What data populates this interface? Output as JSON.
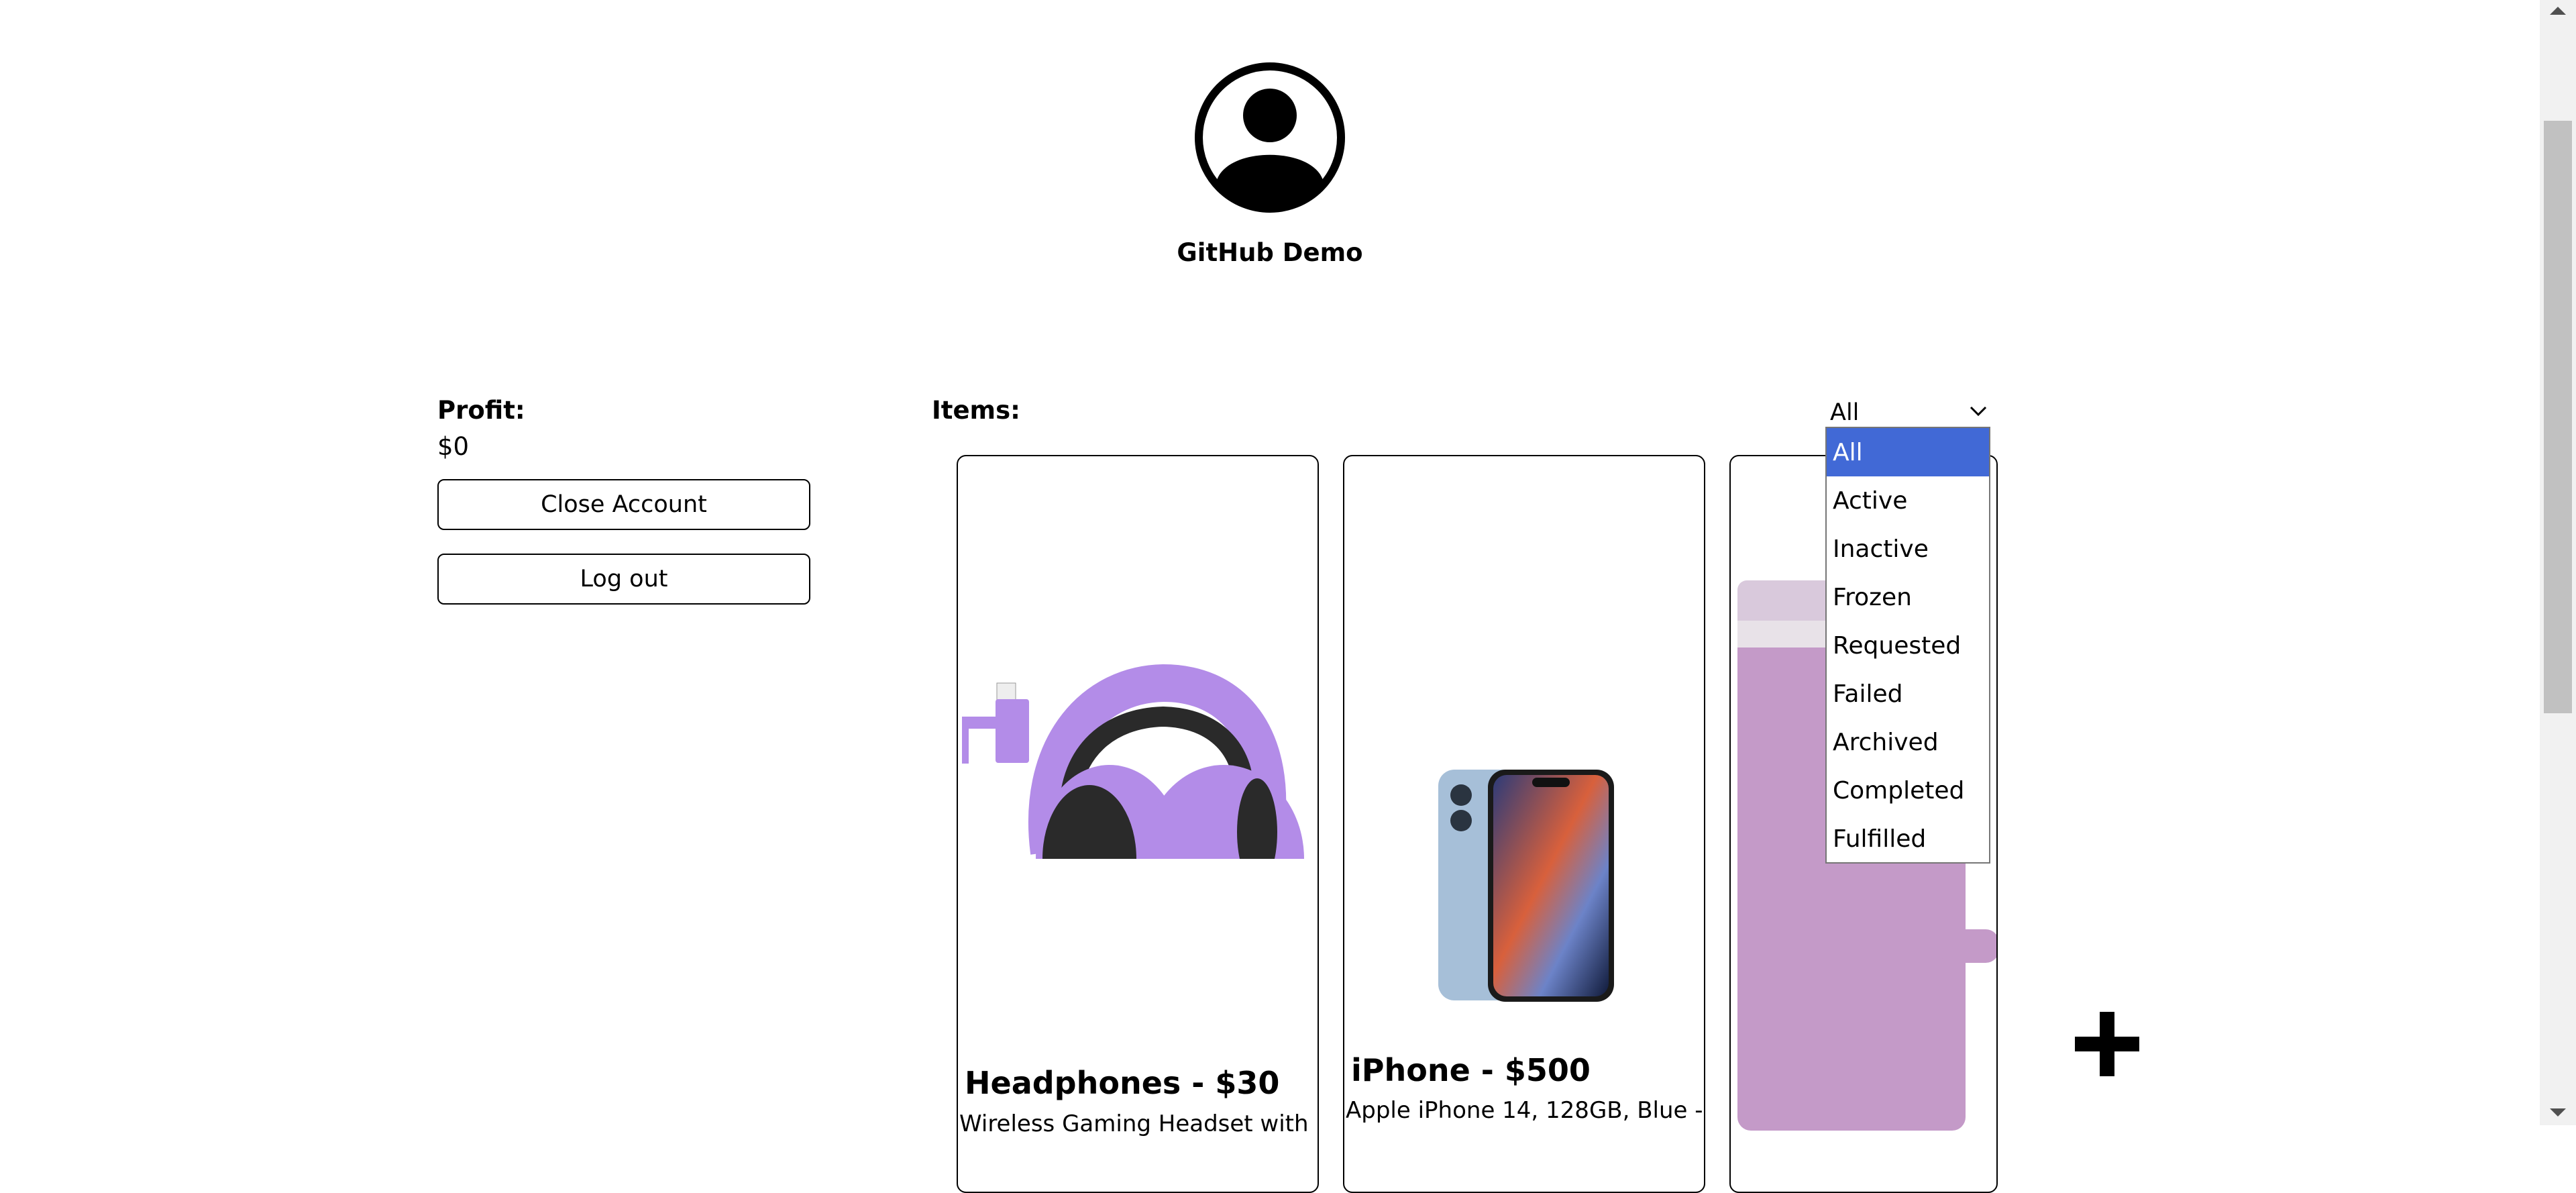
{
  "profile": {
    "username": "GitHub Demo"
  },
  "profit": {
    "label": "Profit:",
    "value": "$0"
  },
  "account": {
    "close_label": "Close Account",
    "logout_label": "Log out"
  },
  "items": {
    "label": "Items:",
    "filter": {
      "selected": "All",
      "options": [
        "All",
        "Active",
        "Inactive",
        "Frozen",
        "Requested",
        "Failed",
        "Archived",
        "Completed",
        "Fulfilled"
      ]
    },
    "cards": [
      {
        "title": "Headphones - $30",
        "description": "Wireless Gaming Headset with"
      },
      {
        "title": "iPhone - $500",
        "description": "Apple iPhone 14, 128GB, Blue -"
      },
      {
        "title": "",
        "description": ""
      }
    ]
  },
  "icons": {
    "avatar": "user-avatar-icon",
    "chevron": "chevron-down-icon",
    "add": "plus-icon"
  },
  "colors": {
    "selected_option": "#4169d6",
    "headphones": "#b38ce8",
    "tumbler": "#c49ac8"
  }
}
